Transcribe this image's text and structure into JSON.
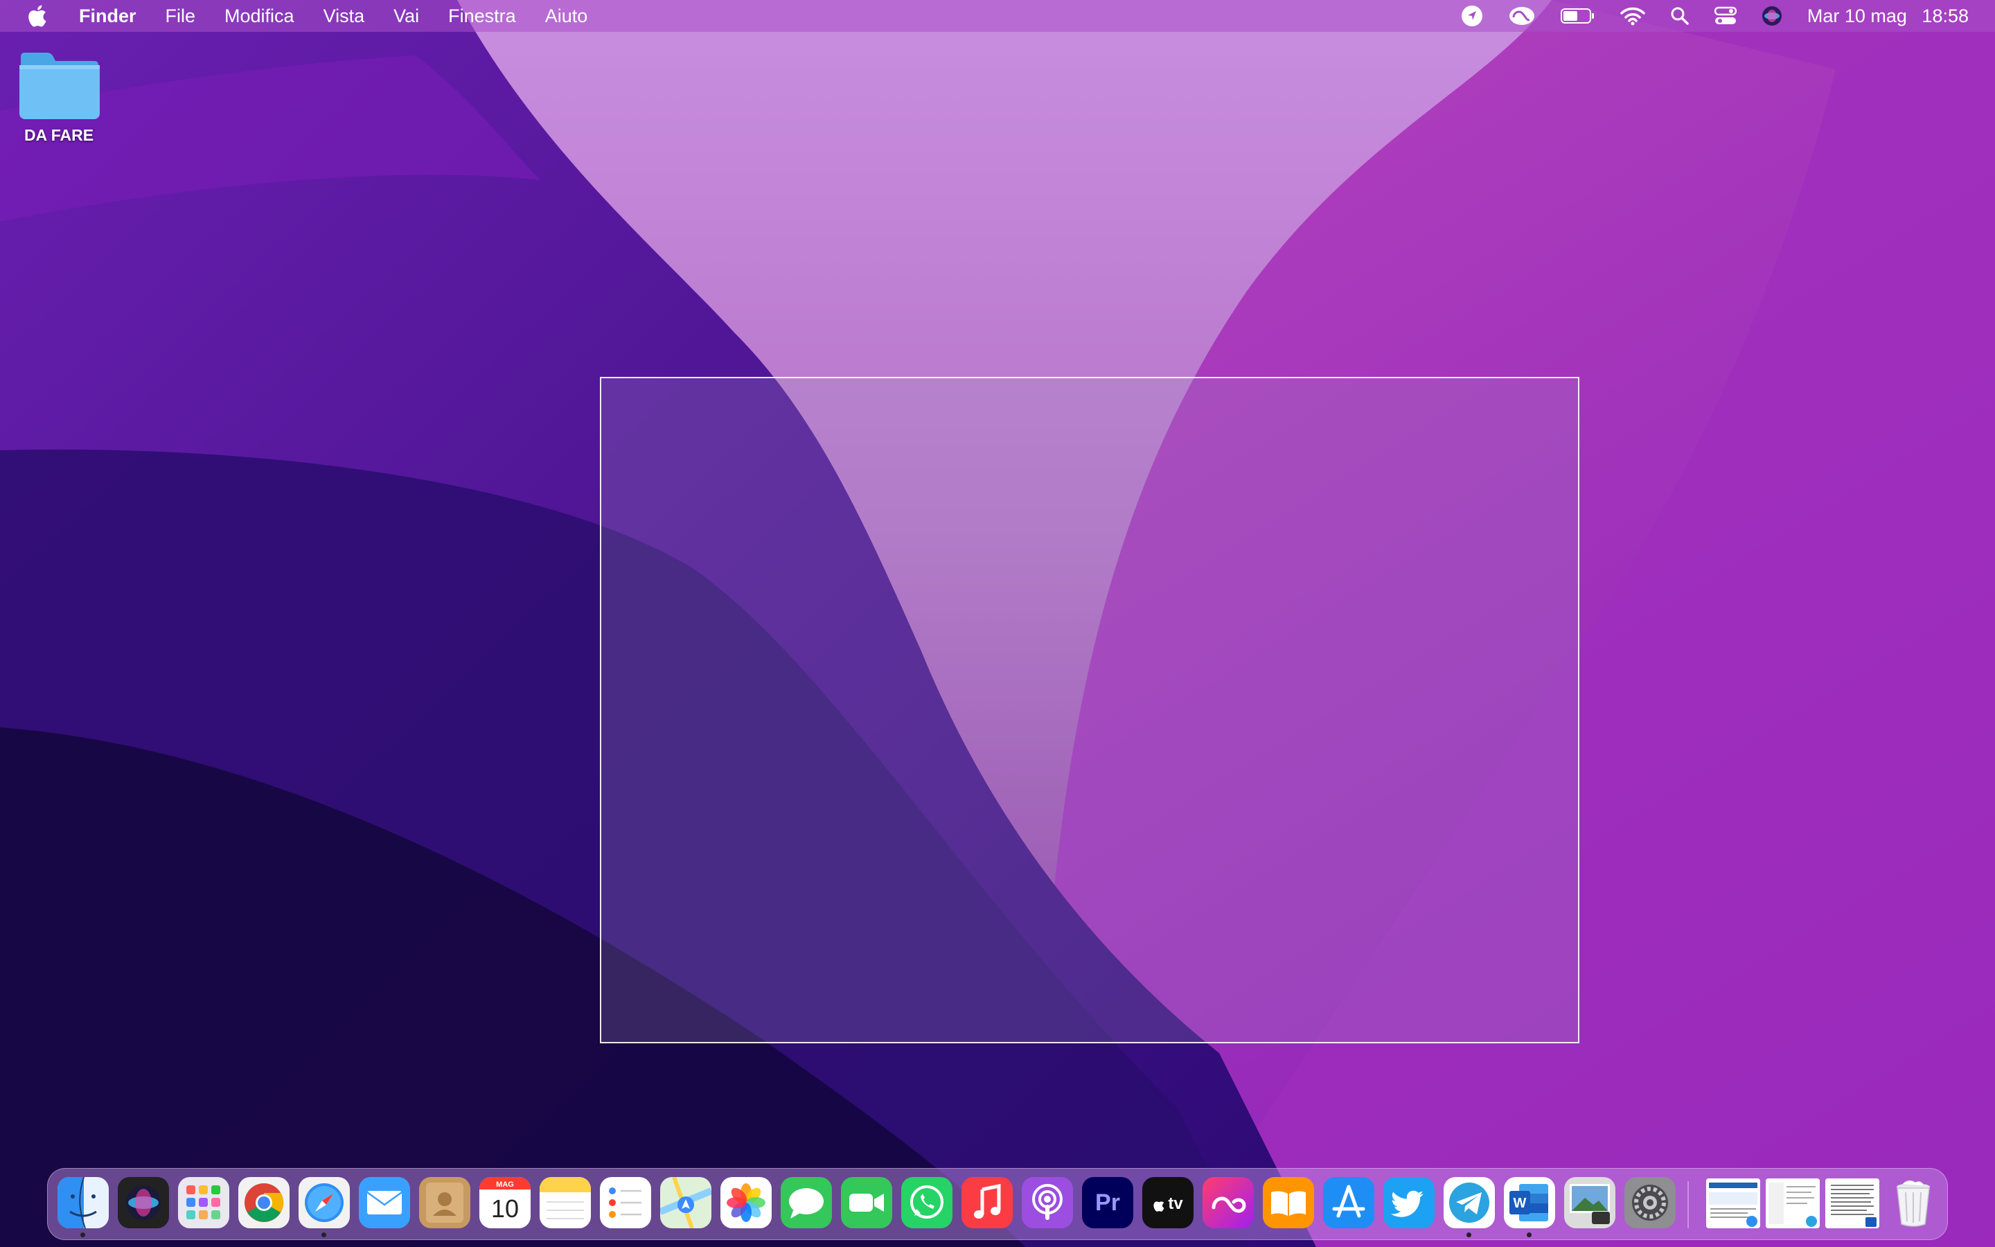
{
  "menubar": {
    "app_name": "Finder",
    "menus": [
      "File",
      "Modifica",
      "Vista",
      "Vai",
      "Finestra",
      "Aiuto"
    ],
    "status_icons": [
      "location-icon",
      "creative-cloud-icon",
      "battery-icon",
      "wifi-icon",
      "spotlight-search-icon",
      "control-center-icon",
      "siri-icon"
    ],
    "date": "Mar 10 mag",
    "time": "18:58"
  },
  "desktop": {
    "folder_label": "DA FARE"
  },
  "dock": {
    "calendar_month": "MAG",
    "calendar_day": "10",
    "premiere_label": "Pr",
    "appletv_label": "tv",
    "word_label": "W",
    "apps": [
      "finder",
      "siri",
      "launchpad",
      "chrome",
      "safari",
      "mail",
      "contacts",
      "calendar",
      "notes",
      "reminders",
      "maps",
      "photos",
      "messages",
      "facetime",
      "whatsapp",
      "music",
      "podcasts",
      "premiere-pro",
      "apple-tv",
      "creative-cloud",
      "books",
      "app-store",
      "twitter",
      "telegram",
      "word",
      "preview",
      "system-preferences"
    ],
    "running": [
      "finder",
      "safari",
      "telegram",
      "word"
    ]
  }
}
